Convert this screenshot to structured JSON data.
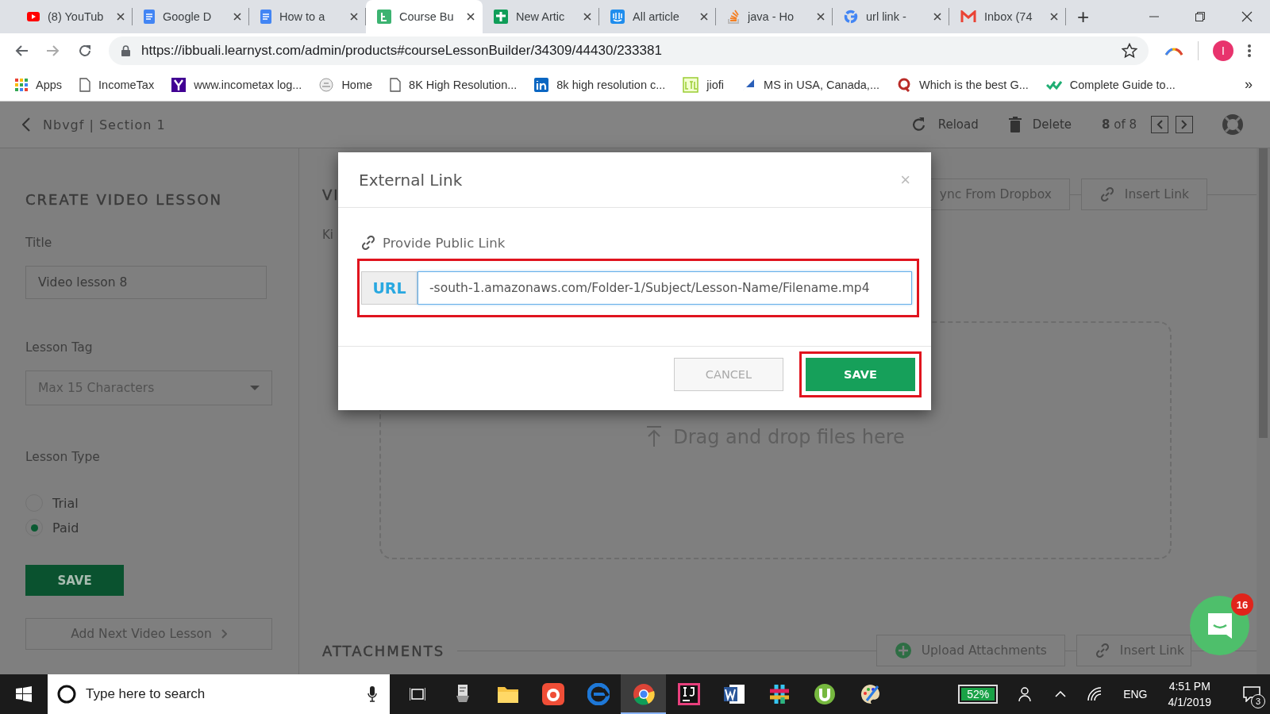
{
  "browser": {
    "tabs": [
      {
        "title": "(8) YouTub",
        "selected": false
      },
      {
        "title": "Google D",
        "selected": false
      },
      {
        "title": "How to a",
        "selected": false
      },
      {
        "title": "Course Bu",
        "selected": true
      },
      {
        "title": "New Artic",
        "selected": false
      },
      {
        "title": "All article",
        "selected": false
      },
      {
        "title": "java - Ho",
        "selected": false
      },
      {
        "title": "url link -",
        "selected": false
      },
      {
        "title": "Inbox (74",
        "selected": false
      }
    ],
    "new_tab": "+",
    "address": "https://ibbuali.learnyst.com/admin/products#courseLessonBuilder/34309/44430/233381",
    "profile_initial": "I",
    "bookmarks": [
      {
        "label": "Apps"
      },
      {
        "label": "IncomeTax"
      },
      {
        "label": "www.incometax log..."
      },
      {
        "label": "Home"
      },
      {
        "label": "8K High Resolution..."
      },
      {
        "label": "8k high resolution c..."
      },
      {
        "label": "jiofi"
      },
      {
        "label": "MS in USA, Canada,..."
      },
      {
        "label": "Which is the best G..."
      },
      {
        "label": "Complete Guide to..."
      }
    ],
    "more_bookmarks": "»"
  },
  "app_header": {
    "breadcrumb": "Nbvgf | Section 1",
    "reload": "Reload",
    "delete": "Delete",
    "pager": "**8** of 8"
  },
  "lesson_form": {
    "heading": "CREATE VIDEO LESSON",
    "title_label": "Title",
    "title_value": "Video lesson 8",
    "tag_label": "Lesson Tag",
    "tag_placeholder": "Max 15 Characters",
    "type_label": "Lesson Type",
    "type_options": [
      {
        "label": "Trial",
        "selected": false
      },
      {
        "label": "Paid",
        "selected": true
      }
    ],
    "save": "SAVE",
    "add_next": "Add Next Video Lesson"
  },
  "media_panel": {
    "heading": "VI",
    "kind_label": "Ki",
    "dropbox_button": "ync From Dropbox",
    "insert_link": "Insert Link",
    "dropzone": "Drag and drop files here",
    "attachments_heading": "ATTACHMENTS",
    "upload_attachments": "Upload Attachments",
    "attachments_insert_link": "Insert Link"
  },
  "modal": {
    "title": "External Link",
    "close": "×",
    "section_label": "Provide Public Link",
    "url_addon": "URL",
    "url_value": "-south-1.amazonaws.com/Folder-1/Subject/Lesson-Name/Filename.mp4",
    "url_highlighted": true,
    "cancel": "CANCEL",
    "save": "SAVE",
    "save_highlighted": true
  },
  "chat": {
    "badge": "16"
  },
  "taskbar": {
    "search_placeholder": "Type here to search",
    "apps": [
      {
        "active": false
      },
      {
        "active": false
      },
      {
        "active": false
      },
      {
        "active": false
      },
      {
        "active": false
      },
      {
        "active": true
      },
      {
        "active": false
      },
      {
        "active": false
      },
      {
        "active": false
      },
      {
        "active": false
      },
      {
        "active": false
      }
    ],
    "battery": "52%",
    "language": "ENG",
    "time": "4:51 PM",
    "date": "4/1/2019",
    "notifications": "3"
  }
}
